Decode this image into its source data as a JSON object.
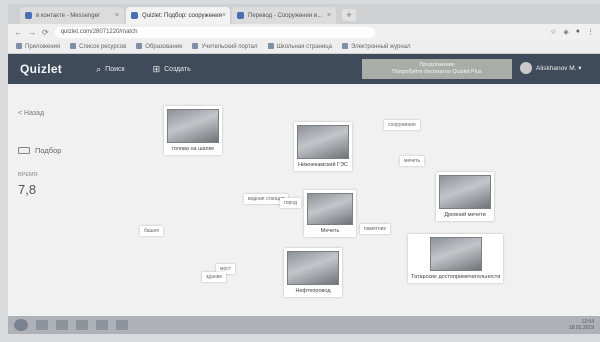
{
  "browser": {
    "tabs": [
      {
        "title": "в контакте - Messenger"
      },
      {
        "title": "Quizlet: Подбор: сооружения"
      },
      {
        "title": "Перевод - Сооружения и..."
      }
    ],
    "url": "quizlet.com/28071220/match",
    "bookmarks": [
      "Приложения",
      "Список ресурсов",
      "Образование",
      "Учительский портал",
      "Школьная страница",
      "Электронный журнал"
    ]
  },
  "quizlet": {
    "logo": "Quizlet",
    "search_label": "Поиск",
    "create_label": "Создать",
    "promo_line1": "Предложение",
    "promo_line2": "Попробуйте бесплатно Quizlet Plus",
    "user_name": "Aliskhanov M."
  },
  "sidebar": {
    "back_label": "< Назад",
    "mode_label": "Подбор",
    "timer_label": "ВРЕМЯ",
    "timer_value": "7,8"
  },
  "board": {
    "cards": [
      {
        "caption": "голова на шапке"
      },
      {
        "caption": "Нижнекамский ГЭС"
      },
      {
        "caption": "Древний мечети"
      },
      {
        "caption": "Мечеть"
      },
      {
        "caption": "Нефтепровод"
      },
      {
        "caption": "Татарские достопримечательности"
      }
    ],
    "words": [
      "сооружение",
      "мечеть",
      "водная станция",
      "город",
      "башня",
      "памятник",
      "мост",
      "здание"
    ]
  },
  "taskbar": {
    "time": "12:54",
    "date": "18.02.2019"
  }
}
